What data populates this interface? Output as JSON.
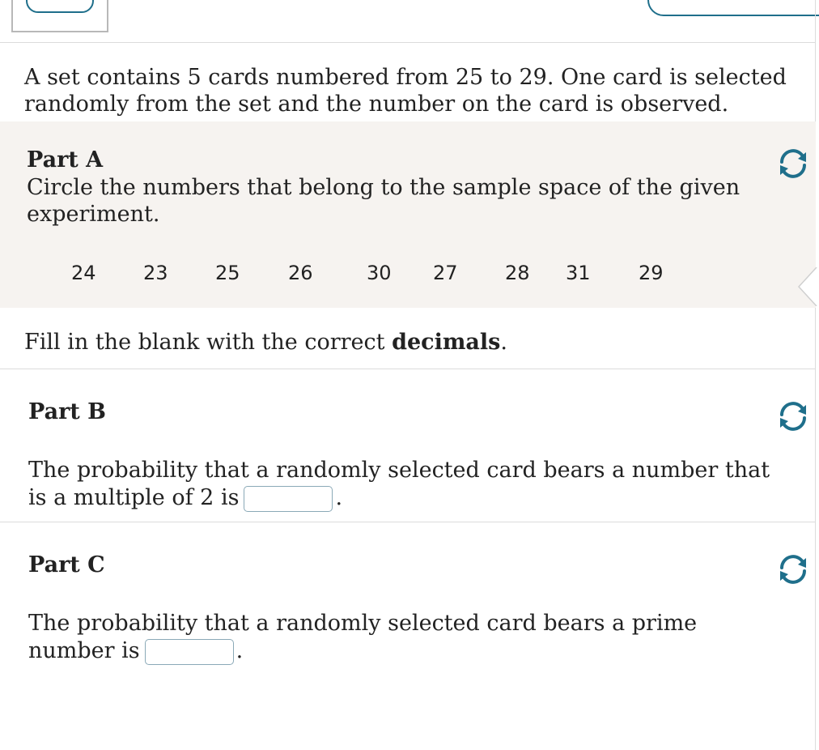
{
  "intro": {
    "line1": "A set contains 5 cards numbered from 25 to 29. One card is selected",
    "line2": "randomly from the set and the number on the card is observed."
  },
  "partA": {
    "heading": "Part A",
    "line1": "Circle the numbers that belong to the sample space of the given",
    "line2": "experiment.",
    "choices": [
      "24",
      "23",
      "25",
      "26",
      "30",
      "27",
      "28",
      "31",
      "29"
    ]
  },
  "instruction": {
    "prefix": "Fill in the blank with the correct ",
    "bold": "decimals",
    "suffix": "."
  },
  "partB": {
    "heading": "Part B",
    "line1": "The probability that a randomly selected card bears a number that",
    "line2_prefix": "is a multiple of 2 is",
    "line2_suffix": ".",
    "answer_value": ""
  },
  "partC": {
    "heading": "Part C",
    "line1": "The probability that a randomly selected card bears a prime",
    "line2_prefix": "number is",
    "line2_suffix": ".",
    "answer_value": ""
  },
  "colors": {
    "accent": "#1f6f8b",
    "panel": "#f6f3f0",
    "rule": "#dcdcdc"
  },
  "icons": {
    "reset": "reload-icon"
  }
}
